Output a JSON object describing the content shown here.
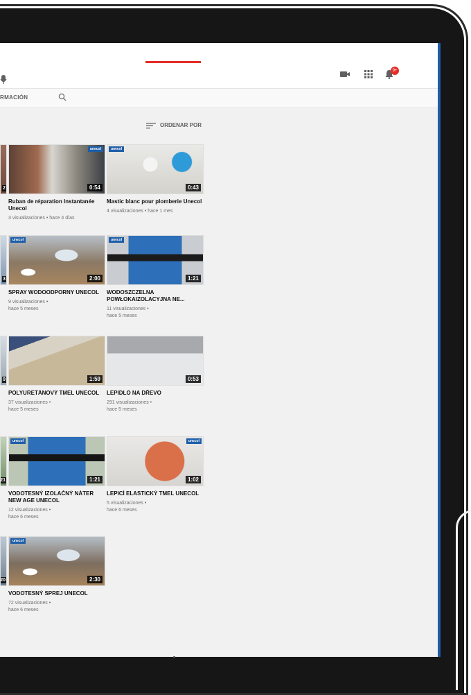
{
  "tabs": {
    "active_fragment": "RMACIÓN"
  },
  "toolbar": {
    "sort_label": "ORDENAR POR",
    "notification_count": "9+"
  },
  "videos": [
    {
      "title": "Ruban de réparation Instantanée Unecol",
      "views": "3 visualizaciones",
      "age": "hace 4 días",
      "duration": "0:54",
      "logo": "unecol"
    },
    {
      "title": "Mastic blanc pour plomberie Unecol",
      "views": "4 visualizaciones",
      "age": "hace 1 mes",
      "duration": "0:43",
      "logo": "unecol"
    },
    {
      "title": "SPRAY WODOODPORNY UNECOL",
      "views": "9 visualizaciones",
      "age": "hace 5 meses",
      "duration": "2:00",
      "logo": "unecol"
    },
    {
      "title": "WODOSZCZELNA POWŁOKAIZOLACYJNA NE...",
      "views": "11 visualizaciones",
      "age": "hace 5 meses",
      "duration": "1:21",
      "logo": "unecol"
    },
    {
      "title": "POLYURETÁNOVÝ TMEL UNECOL",
      "views": "37 visualizaciones",
      "age": "hace 5 meses",
      "duration": "1:59",
      "logo": ""
    },
    {
      "title": "LEPIDLO NA DŘEVO",
      "views": "291 visualizaciones",
      "age": "hace 5 meses",
      "duration": "0:53",
      "logo": ""
    },
    {
      "title": "VODOTESNÝ IZOLAČNÝ NÁTER NEW AGE UNECOL",
      "views": "12 visualizaciones",
      "age": "hace 6 meses",
      "duration": "1:21",
      "logo": "unecol"
    },
    {
      "title": "LEPICÍ ELASTICKÝ TMEL UNECOL",
      "views": "5 visualizaciones",
      "age": "hace 6 meses",
      "duration": "1:02",
      "logo": "unecol"
    },
    {
      "title": "VODOTESNÝ SPREJ UNECOL",
      "views": "72 visualizaciones",
      "age": "hace 6 meses",
      "duration": "2:30",
      "logo": "unecol"
    }
  ],
  "left_column_durations": [
    "2",
    "3",
    "9",
    "21",
    "20"
  ]
}
